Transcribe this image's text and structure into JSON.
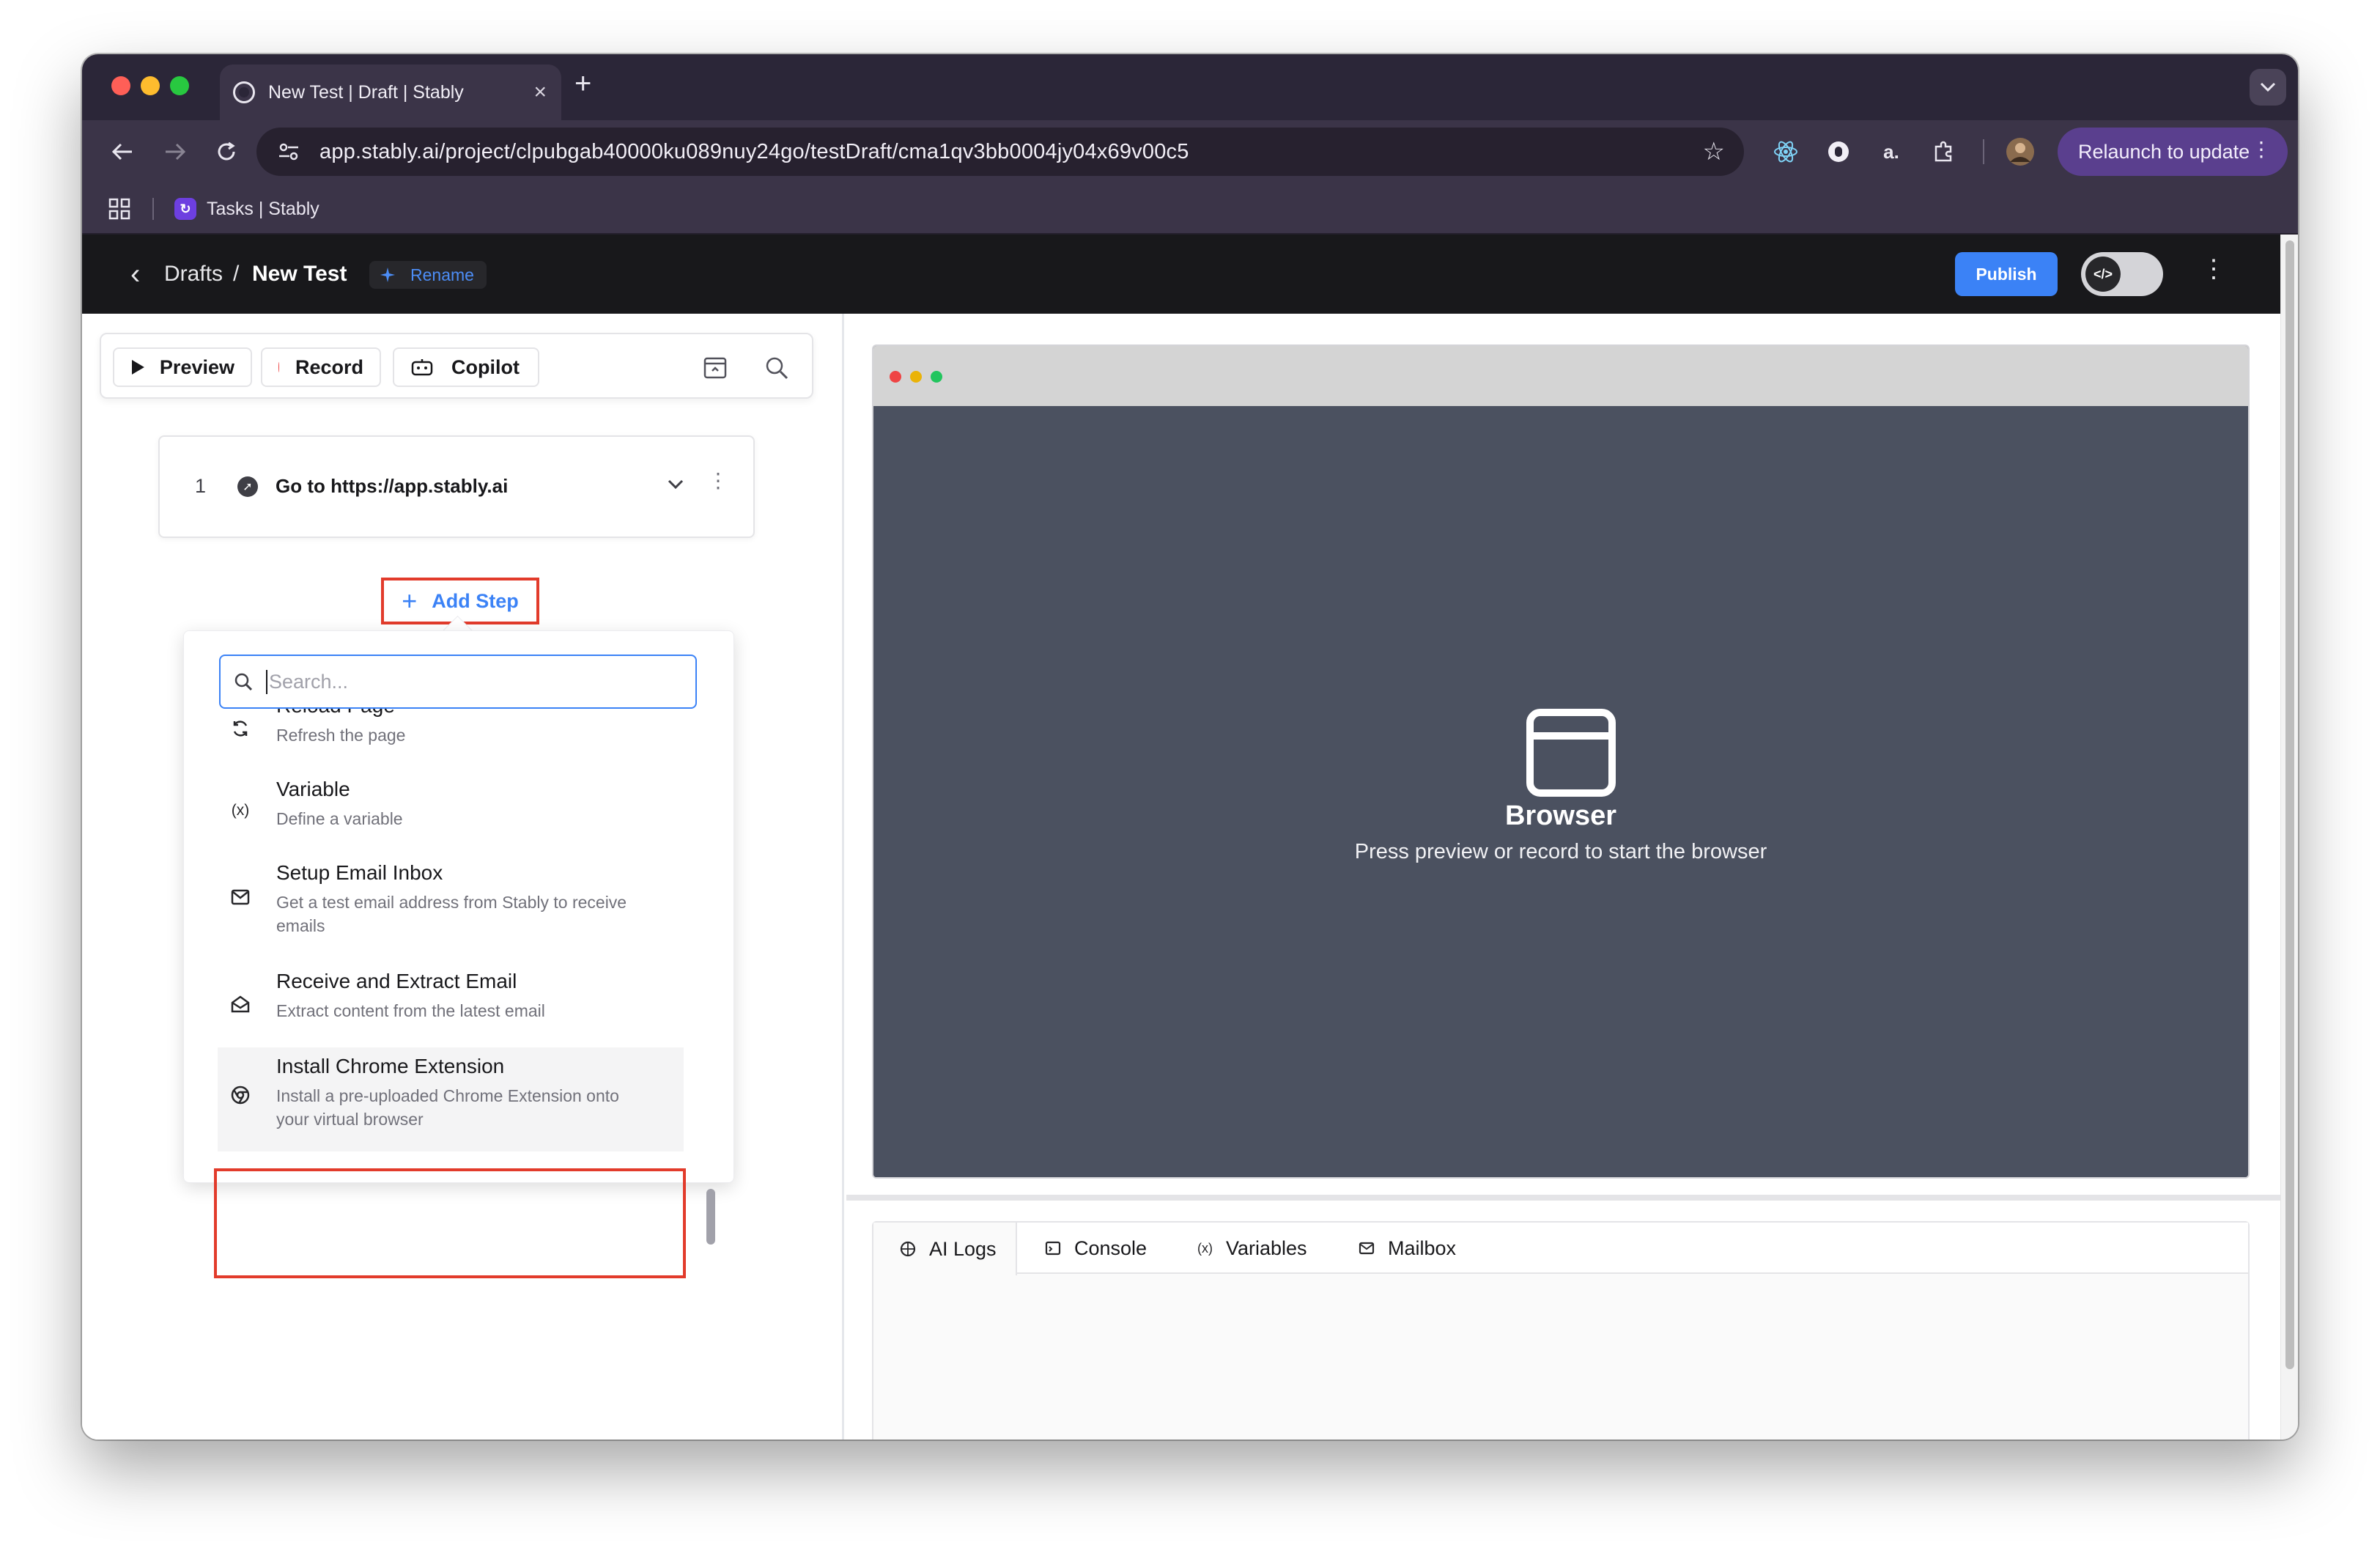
{
  "browser": {
    "tab_title": "New Test | Draft | Stably",
    "tab_close": "×",
    "new_tab": "+",
    "url": "app.stably.ai/project/clpubgab40000ku089nuy24go/testDraft/cma1qv3bb0004jy04x69v00c5",
    "relaunch_label": "Relaunch to update",
    "bookmark_label": "Tasks | Stably",
    "extension_amazon_label": "a.",
    "traffic_colors": [
      "#ff5f57",
      "#febc2e",
      "#28c840"
    ]
  },
  "header": {
    "back": "‹",
    "breadcrumb_parent": "Drafts",
    "separator": "/",
    "title": "New Test",
    "rename_label": "Rename",
    "publish_label": "Publish",
    "accent": "#3b82f6"
  },
  "toolbar": {
    "preview_label": "Preview",
    "record_label": "Record",
    "copilot_label": "Copilot"
  },
  "steps": [
    {
      "number": "1",
      "label": "Go to https://app.stably.ai"
    }
  ],
  "add_step_label": "Add Step",
  "step_menu": {
    "search_placeholder": "Search...",
    "items": [
      {
        "title": "Reload Page",
        "description": "Refresh the page",
        "icon": "refresh-icon"
      },
      {
        "title": "Variable",
        "description": "Define a variable",
        "icon": "variable-icon"
      },
      {
        "title": "Setup Email Inbox",
        "description": "Get a test email address from Stably to receive emails",
        "icon": "mail-icon"
      },
      {
        "title": "Receive and Extract Email",
        "description": "Extract content from the latest email",
        "icon": "mail-open-icon"
      },
      {
        "title": "Install Chrome Extension",
        "description": "Install a pre-uploaded Chrome Extension onto your virtual browser",
        "icon": "chrome-icon",
        "highlighted": true
      }
    ]
  },
  "browser_preview": {
    "title": "Browser",
    "subtitle": "Press preview or record to start the browser"
  },
  "bottom_tabs": [
    {
      "label": "AI Logs",
      "icon": "ai-icon",
      "active": true
    },
    {
      "label": "Console",
      "icon": "console-icon",
      "active": false
    },
    {
      "label": "Variables",
      "icon": "variable-icon",
      "active": false
    },
    {
      "label": "Mailbox",
      "icon": "mail-icon",
      "active": false
    }
  ]
}
